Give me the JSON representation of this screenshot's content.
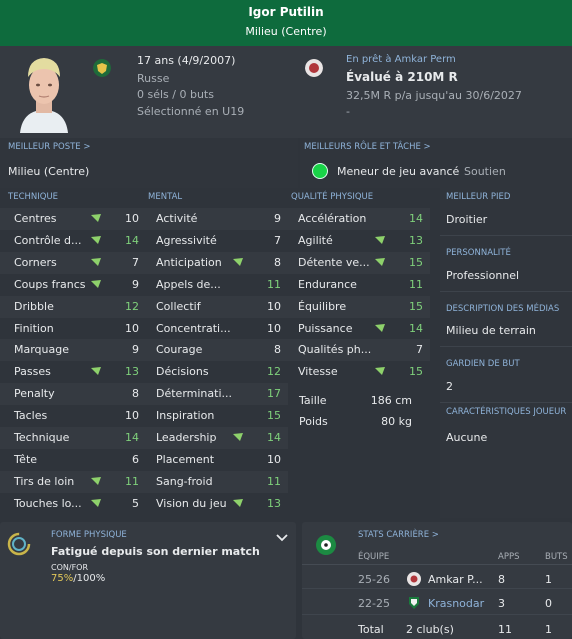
{
  "header": {
    "name": "Igor Putilin",
    "position": "Milieu (Centre)"
  },
  "profile": {
    "age": "17 ans (4/9/2007)",
    "nationality": "Russe",
    "goals": "0 séls / 0 buts",
    "selection": "Sélectionné en U19",
    "loan": "En prêt à Amkar Perm",
    "value": "Évalué à 210M R",
    "contract": "32,5M R p/a jusqu'au 30/6/2027",
    "dash": "-"
  },
  "best_position": {
    "title": "MEILLEUR POSTE >",
    "value": "Milieu (Centre)"
  },
  "best_role": {
    "title": "MEILLEURS RÔLE ET TÂCHE >",
    "role": "Meneur de jeu avancé",
    "duty": "Soutien"
  },
  "sections": {
    "technique": "TECHNIQUE",
    "mental": "MENTAL",
    "physical": "QUALITÉ PHYSIQUE"
  },
  "technique": [
    {
      "name": "Centres",
      "value": "10",
      "up": true
    },
    {
      "name": "Contrôle d...",
      "value": "14",
      "up": true
    },
    {
      "name": "Corners",
      "value": "7",
      "up": true
    },
    {
      "name": "Coups francs",
      "value": "9",
      "up": true
    },
    {
      "name": "Dribble",
      "value": "12",
      "up": false
    },
    {
      "name": "Finition",
      "value": "10",
      "up": false
    },
    {
      "name": "Marquage",
      "value": "9",
      "up": false
    },
    {
      "name": "Passes",
      "value": "13",
      "up": true
    },
    {
      "name": "Penalty",
      "value": "8",
      "up": false
    },
    {
      "name": "Tacles",
      "value": "10",
      "up": false
    },
    {
      "name": "Technique",
      "value": "14",
      "up": false
    },
    {
      "name": "Tête",
      "value": "6",
      "up": false
    },
    {
      "name": "Tirs de loin",
      "value": "11",
      "up": true
    },
    {
      "name": "Touches lo...",
      "value": "5",
      "up": true
    }
  ],
  "mental": [
    {
      "name": "Agressivité",
      "value": "7",
      "up": false
    },
    {
      "name": "Anticipation",
      "value": "8",
      "up": true
    },
    {
      "name": "Appels de...",
      "value": "11",
      "up": false
    },
    {
      "name": "Collectif",
      "value": "10",
      "up": false
    },
    {
      "name": "Concentrati...",
      "value": "10",
      "up": false
    },
    {
      "name": "Courage",
      "value": "8",
      "up": false
    },
    {
      "name": "Décisions",
      "value": "12",
      "up": false
    },
    {
      "name": "Déterminati...",
      "value": "17",
      "up": false
    },
    {
      "name": "Inspiration",
      "value": "15",
      "up": false
    },
    {
      "name": "Leadership",
      "value": "14",
      "up": true
    },
    {
      "name": "Placement",
      "value": "10",
      "up": false
    },
    {
      "name": "Sang-froid",
      "value": "11",
      "up": false
    },
    {
      "name": "Vision du jeu",
      "value": "13",
      "up": true
    }
  ],
  "mental_first": {
    "name": "Activité",
    "value": "9"
  },
  "physical": [
    {
      "name": "Accélération",
      "value": "14",
      "up": false
    },
    {
      "name": "Agilité",
      "value": "13",
      "up": true
    },
    {
      "name": "Détente ve...",
      "value": "15",
      "up": true
    },
    {
      "name": "Endurance",
      "value": "11",
      "up": false
    },
    {
      "name": "Équilibre",
      "value": "15",
      "up": false
    },
    {
      "name": "Puissance",
      "value": "14",
      "up": true
    },
    {
      "name": "Qualités ph...",
      "value": "7",
      "up": false
    },
    {
      "name": "Vitesse",
      "value": "15",
      "up": true
    }
  ],
  "body": {
    "height_label": "Taille",
    "height": "186 cm",
    "weight_label": "Poids",
    "weight": "80 kg"
  },
  "side": {
    "foot_title": "MEILLEUR PIED",
    "foot": "Droitier",
    "personality_title": "PERSONNALITÉ",
    "personality": "Professionnel",
    "media_title": "DESCRIPTION DES MÉDIAS",
    "media": "Milieu de terrain",
    "gk_title": "GARDIEN DE BUT",
    "gk": "2",
    "traits_title": "CARACTÉRISTIQUES JOUEUR",
    "traits": "Aucune"
  },
  "fitness": {
    "title": "FORME PHYSIQUE",
    "status": "Fatigué depuis son dernier match",
    "con_label": "CON/FOR",
    "con_value": "75%",
    "for_value": "/100%"
  },
  "career": {
    "title": "STATS CARRIÈRE >",
    "headers": {
      "team": "ÉQUIPE",
      "apps": "APPS",
      "goals": "BUTS"
    },
    "rows": [
      {
        "season": "25-26",
        "club": "Amkar P...",
        "apps": "8",
        "goals": "1"
      },
      {
        "season": "22-25",
        "club": "Krasnodar",
        "apps": "3",
        "goals": "0"
      }
    ],
    "total": {
      "label": "Total",
      "clubs": "2 club(s)",
      "apps": "11",
      "goals": "1"
    }
  },
  "colors": {
    "green_value": "#7fd07b",
    "header_green": "#0e6b3d",
    "link": "#8fb3d9"
  }
}
